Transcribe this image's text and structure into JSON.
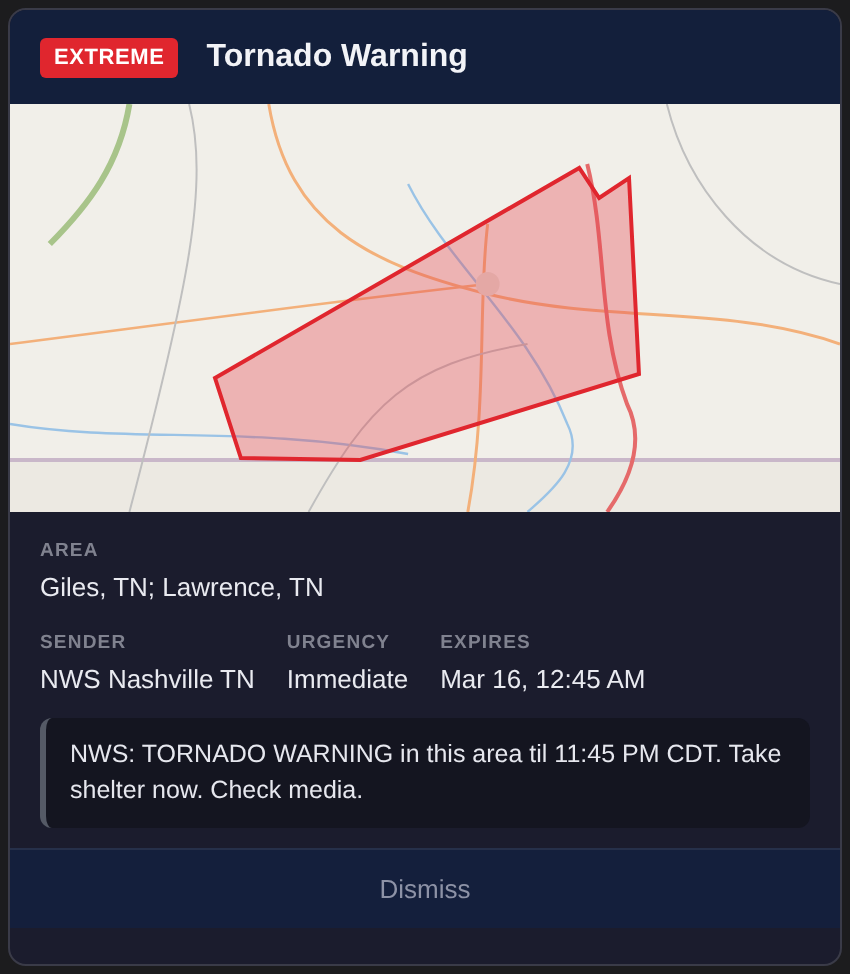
{
  "alert": {
    "severity": "EXTREME",
    "title": "Tornado Warning"
  },
  "area": {
    "label": "AREA",
    "value": "Giles, TN; Lawrence, TN"
  },
  "details": [
    {
      "label": "SENDER",
      "value": "NWS Nashville TN"
    },
    {
      "label": "URGENCY",
      "value": "Immediate"
    },
    {
      "label": "EXPIRES",
      "value": "Mar 16, 12:45 AM"
    }
  ],
  "message": "NWS: TORNADO WARNING in this area til 11:45 PM CDT. Take shelter now. Check media.",
  "dismiss": "Dismiss"
}
